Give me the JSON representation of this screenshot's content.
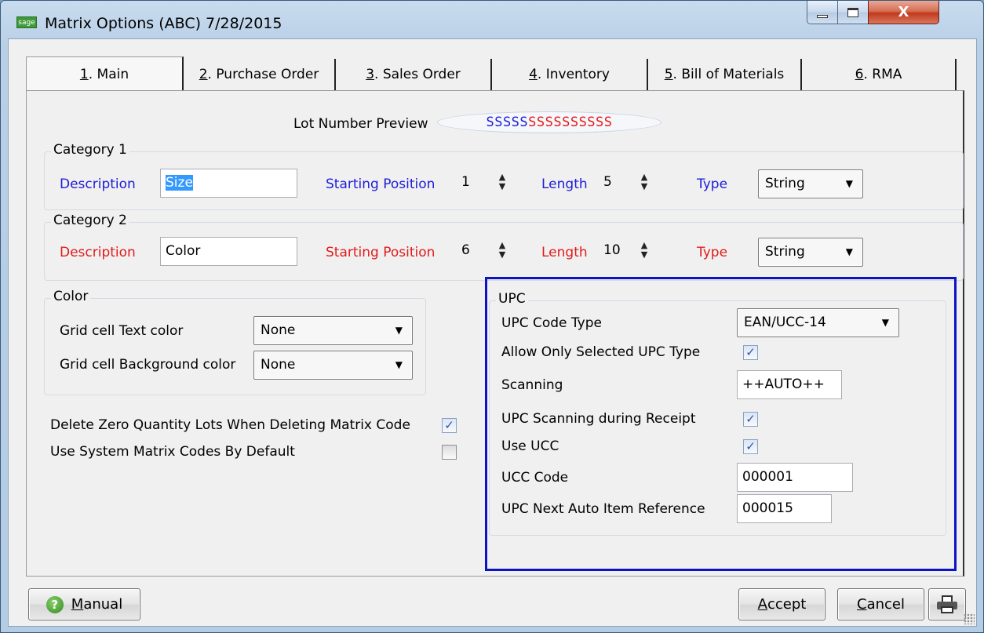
{
  "window": {
    "title": "Matrix Options (ABC) 7/28/2015",
    "logo_text": "sage",
    "close_glyph": "X"
  },
  "tabs": [
    {
      "key": "1",
      "label": ". Main"
    },
    {
      "key": "2",
      "label": ". Purchase Order"
    },
    {
      "key": "3",
      "label": ". Sales Order"
    },
    {
      "key": "4",
      "label": ". Inventory"
    },
    {
      "key": "5",
      "label": ". Bill of Materials"
    },
    {
      "key": "6",
      "label": ". RMA"
    }
  ],
  "lot_preview": {
    "label": "Lot Number Preview",
    "part1": "SSSSS",
    "part2": "SSSSSSSSSS"
  },
  "category1": {
    "title": "Category 1",
    "description_label": "Description",
    "description_value": "Size",
    "start_label": "Starting Position",
    "start_value": "1",
    "length_label": "Length",
    "length_value": "5",
    "type_label": "Type",
    "type_value": "String"
  },
  "category2": {
    "title": "Category 2",
    "description_label": "Description",
    "description_value": "Color",
    "start_label": "Starting Position",
    "start_value": "6",
    "length_label": "Length",
    "length_value": "10",
    "type_label": "Type",
    "type_value": "String"
  },
  "color_group": {
    "title": "Color",
    "text_color_label": "Grid cell Text color",
    "text_color_value": "None",
    "bg_color_label": "Grid cell Background color",
    "bg_color_value": "None"
  },
  "options": {
    "delete_zero_label": "Delete Zero Quantity Lots When Deleting Matrix Code",
    "delete_zero_checked": true,
    "use_system_label": "Use System Matrix Codes By Default",
    "use_system_checked": false
  },
  "upc": {
    "title": "UPC",
    "code_type_label": "UPC Code Type",
    "code_type_value": "EAN/UCC-14",
    "allow_only_label": "Allow Only Selected UPC Type",
    "allow_only_checked": true,
    "scanning_label": "Scanning",
    "scanning_value": "++AUTO++",
    "scan_receipt_label": "UPC Scanning during Receipt",
    "scan_receipt_checked": true,
    "use_ucc_label": "Use UCC",
    "use_ucc_checked": true,
    "ucc_code_label": "UCC Code",
    "ucc_code_value": "000001",
    "next_ref_label": "UPC Next Auto Item Reference",
    "next_ref_value": "000015"
  },
  "buttons": {
    "manual_hotkey": "M",
    "manual_rest": "anual",
    "accept_hotkey": "A",
    "accept_rest": "ccept",
    "cancel_hotkey": "C",
    "cancel_rest": "ancel"
  },
  "check_glyph": "✓"
}
